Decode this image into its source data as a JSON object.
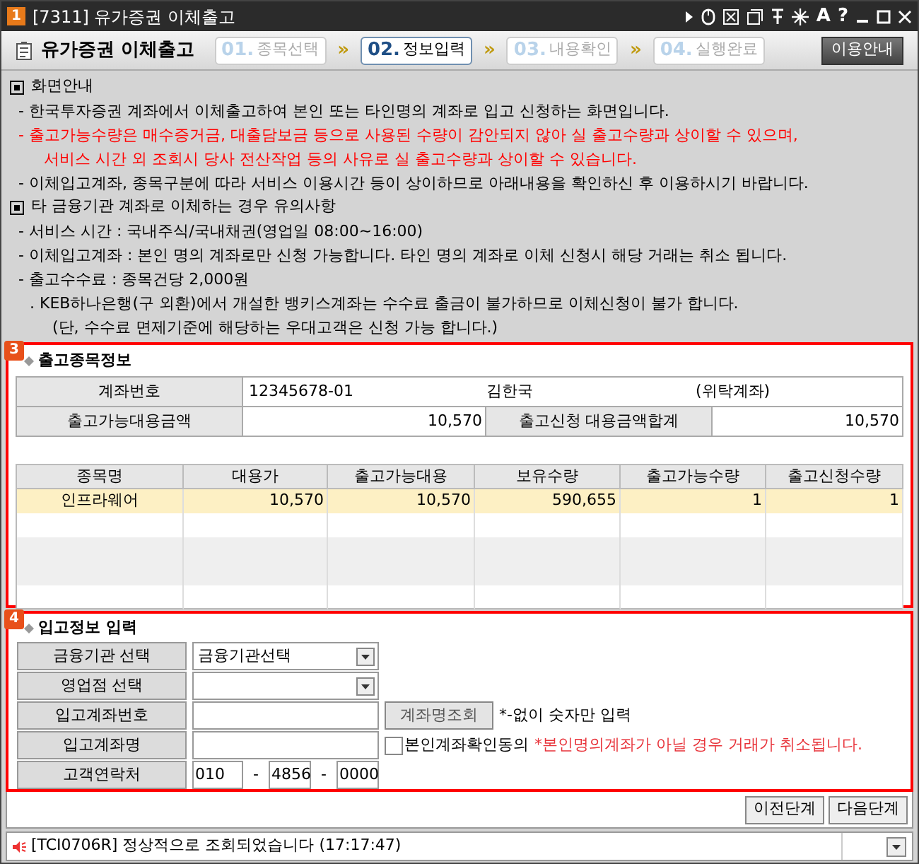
{
  "window": {
    "badge": "1",
    "title": "[7311] 유가증권 이체출고",
    "glyphs": [
      "A",
      "?"
    ]
  },
  "header": {
    "title": "유가증권 이체출고",
    "steps": [
      {
        "number": "01.",
        "label": "종목선택",
        "selected": false
      },
      {
        "number": "02.",
        "label": "정보입력",
        "selected": true
      },
      {
        "number": "03.",
        "label": "내용확인",
        "selected": false
      },
      {
        "number": "04.",
        "label": "실행완료",
        "selected": false
      }
    ],
    "separator": "»",
    "help_button": "이용안내"
  },
  "notice": [
    {
      "heading": "화면안내",
      "lines": [
        {
          "kind": "item",
          "warning": false,
          "text": "- 한국투자증권 계좌에서 이체출고하여 본인 또는 타인명의 계좌로 입고 신청하는 화면입니다."
        },
        {
          "kind": "item",
          "warning": true,
          "text": "- 출고가능수량은 매수증거금, 대출담보금 등으로 사용된 수량이 감안되지 않아 실 출고수량과 상이할 수 있으며,"
        },
        {
          "kind": "continuation",
          "warning": true,
          "text": "서비스 시간 외 조회시 당사 전산작업 등의 사유로 실 출고수량과 상이할 수 있습니다."
        },
        {
          "kind": "item",
          "warning": false,
          "text": "- 이체입고계좌, 종목구분에 따라 서비스 이용시간 등이 상이하므로 아래내용을 확인하신 후 이용하시기 바랍니다."
        }
      ]
    },
    {
      "heading": "타 금융기관 계좌로 이체하는 경우 유의사항",
      "lines": [
        {
          "kind": "item",
          "warning": false,
          "text": "- 서비스 시간 : 국내주식/국내채권(영업일 08:00~16:00)"
        },
        {
          "kind": "item",
          "warning": false,
          "text": "- 이체입고계좌 : 본인 명의 계좌로만 신청 가능합니다. 타인 명의 계좌로 이체 신청시 해당 거래는 취소 됩니다."
        },
        {
          "kind": "item",
          "warning": false,
          "text": "- 출고수수료 : 종목건당 2,000원"
        },
        {
          "kind": "note",
          "warning": false,
          "text": ". KEB하나은행(구 외환)에서 개설한 뱅키스계좌는 수수료 출금이 불가하므로 이체신청이 불가 합니다."
        },
        {
          "kind": "note_continuation",
          "warning": false,
          "text": "(단, 수수료 면제기준에 해당하는 우대고객은 신청 가능 합니다.)"
        }
      ]
    }
  ],
  "holdings": {
    "badge": "3",
    "title": "출고종목정보",
    "account": {
      "label": "계좌번호",
      "number": "12345678-01",
      "name": "김한국",
      "type": "(위탁계좌)"
    },
    "amounts": [
      {
        "label": "출고가능대용금액",
        "value": "10,570"
      },
      {
        "label": "출고신청 대용금액합계",
        "value": "10,570"
      }
    ],
    "table": {
      "columns": [
        "종목명",
        "대용가",
        "출고가능대용",
        "보유수량",
        "출고가능수량",
        "출고신청수량"
      ],
      "rows": [
        {
          "selected": true,
          "cells": [
            "인프라웨어",
            "10,570",
            "10,570",
            "590,655",
            "1",
            "1"
          ]
        }
      ]
    }
  },
  "deposit": {
    "badge": "4",
    "title": "입고정보 입력",
    "fields": [
      {
        "kind": "select",
        "label": "금융기관 선택",
        "value": "금융기관선택"
      },
      {
        "kind": "select",
        "label": "영업점 선택"
      },
      {
        "kind": "account",
        "label": "입고계좌번호",
        "button": "계좌명조회",
        "hint": "*-없이 숫자만 입력"
      },
      {
        "kind": "name",
        "label": "입고계좌명",
        "checkbox": {
          "label": "본인계좌확인동의",
          "checked": false
        },
        "warning": "*본인명의계좌가 아닐 경우 거래가 취소됩니다."
      },
      {
        "kind": "phone",
        "label": "고객연락처",
        "parts": [
          "010",
          "4856",
          "0000"
        ],
        "separators": [
          "-",
          "-"
        ]
      }
    ]
  },
  "buttons": [
    "이전단계",
    "다음단계"
  ],
  "status_bar": {
    "message": "[TCI0706R] 정상적으로 조회되었습니다 (17:17:47)"
  }
}
